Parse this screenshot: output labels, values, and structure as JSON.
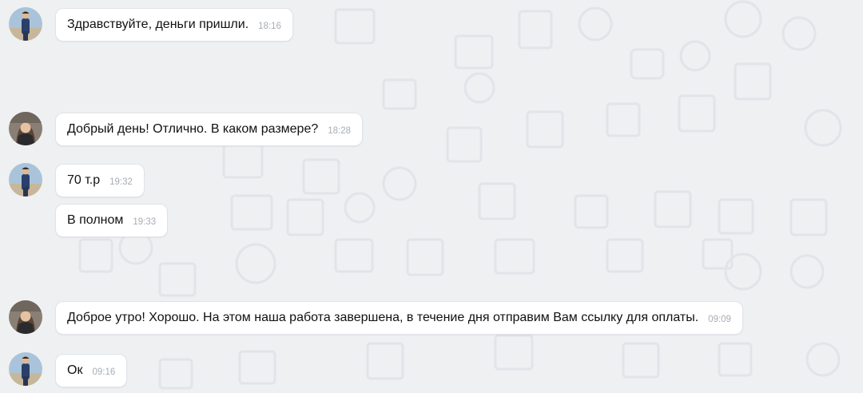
{
  "colors": {
    "background": "#eef0f2",
    "bubble": "#ffffff",
    "text": "#111111",
    "time": "#a7adb4"
  },
  "messages": [
    {
      "sender": "user-a",
      "text": "Здравствуйте, деньги пришли.",
      "time": "18:16",
      "show_avatar": true
    },
    {
      "sender": "user-b",
      "text": "Добрый день! Отлично. В каком размере?",
      "time": "18:28",
      "show_avatar": true
    },
    {
      "sender": "user-a",
      "text": "70 т.р",
      "time": "19:32",
      "show_avatar": true
    },
    {
      "sender": "user-a",
      "text": "В полном",
      "time": "19:33",
      "show_avatar": false
    },
    {
      "sender": "user-b",
      "text": "Доброе утро! Хорошо. На этом наша работа завершена, в течение дня отправим Вам ссылку для оплаты.",
      "time": "09:09",
      "show_avatar": true
    },
    {
      "sender": "user-a",
      "text": "Ок",
      "time": "09:16",
      "show_avatar": true
    }
  ]
}
